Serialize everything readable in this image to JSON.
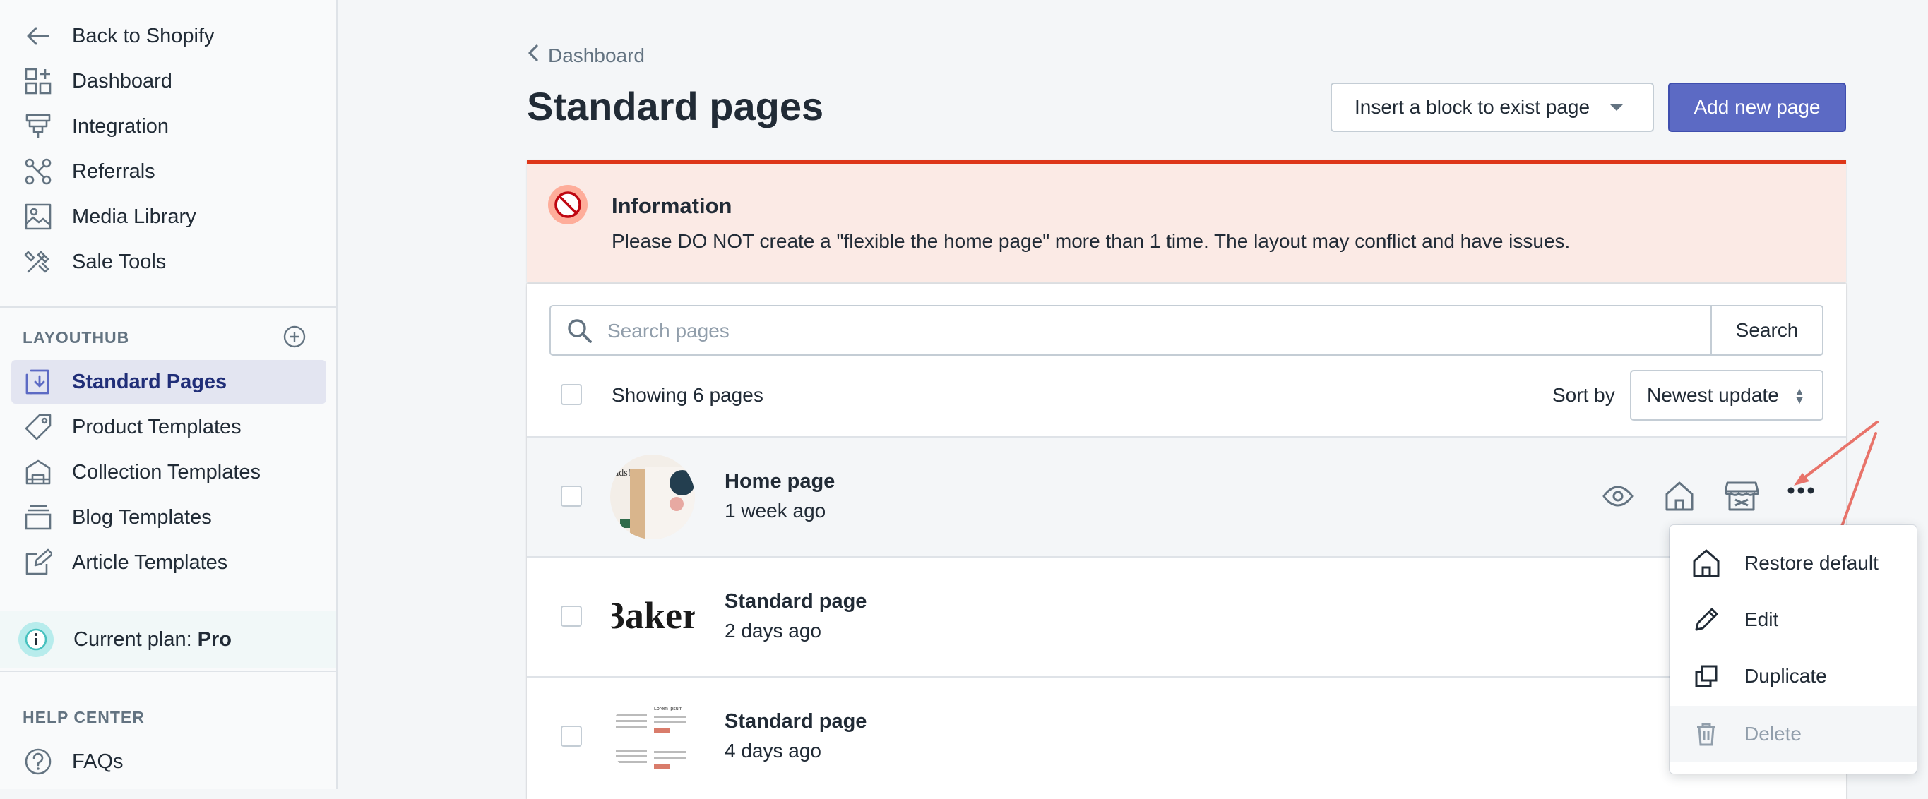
{
  "sidebar": {
    "top_items": [
      {
        "label": "Back to Shopify",
        "icon": "arrow-left-icon"
      },
      {
        "label": "Dashboard",
        "icon": "dashboard-icon"
      },
      {
        "label": "Integration",
        "icon": "integration-icon"
      },
      {
        "label": "Referrals",
        "icon": "referrals-icon"
      },
      {
        "label": "Media Library",
        "icon": "image-icon"
      },
      {
        "label": "Sale Tools",
        "icon": "tools-icon"
      }
    ],
    "section_label": "LAYOUTHUB",
    "layouthub_items": [
      {
        "label": "Standard Pages",
        "icon": "standard-pages-icon",
        "active": true
      },
      {
        "label": "Product Templates",
        "icon": "tag-icon"
      },
      {
        "label": "Collection Templates",
        "icon": "collection-icon"
      },
      {
        "label": "Blog Templates",
        "icon": "blog-icon"
      },
      {
        "label": "Article Templates",
        "icon": "article-icon"
      }
    ],
    "plan": {
      "label": "Current plan:",
      "value": "Pro"
    },
    "help_label": "HELP CENTER",
    "help_items": [
      {
        "label": "FAQs",
        "icon": "question-icon"
      }
    ]
  },
  "header": {
    "breadcrumb": "Dashboard",
    "title": "Standard pages",
    "insert_button": "Insert a block to exist page",
    "add_button": "Add new page"
  },
  "banner": {
    "title": "Information",
    "text": "Please DO NOT create a \"flexible the home page\" more than 1 time. The layout may conflict and have issues."
  },
  "list": {
    "search_placeholder": "Search pages",
    "search_button": "Search",
    "showing": "Showing 6 pages",
    "sort_label": "Sort by",
    "sort_value": "Newest update",
    "rows": [
      {
        "title": "Home page",
        "time": "1 week ago",
        "thumb_text": "ads!"
      },
      {
        "title": "Standard page",
        "time": "2 days ago",
        "thumb_text": "3aker"
      },
      {
        "title": "Standard page",
        "time": "4 days ago",
        "thumb_text": "Lorem ipsum"
      }
    ]
  },
  "popover": {
    "items": [
      {
        "label": "Restore default",
        "icon": "home-icon"
      },
      {
        "label": "Edit",
        "icon": "pencil-icon"
      },
      {
        "label": "Duplicate",
        "icon": "duplicate-icon"
      },
      {
        "label": "Delete",
        "icon": "trash-icon",
        "disabled": true
      }
    ]
  },
  "colors": {
    "accent": "#5c6ac4",
    "critical": "#de3618",
    "banner_bg": "#fbeae5"
  }
}
